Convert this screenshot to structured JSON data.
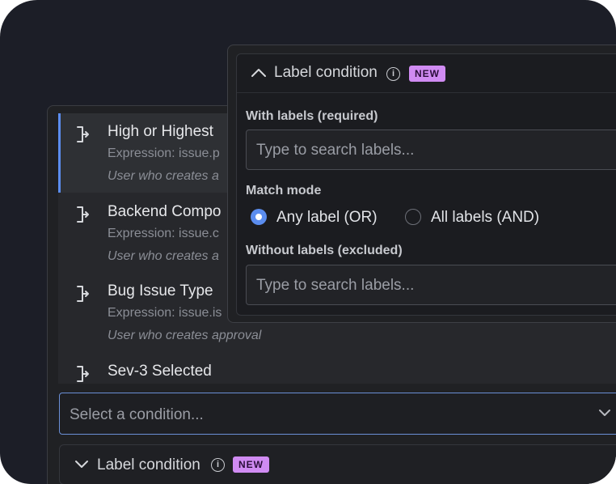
{
  "conditions": [
    {
      "title": "High or Highest",
      "expression": "Expression: issue.p",
      "creator": "User who creates a"
    },
    {
      "title": "Backend Compo",
      "expression": "Expression: issue.c",
      "creator": "User who creates a"
    },
    {
      "title": "Bug Issue Type",
      "expression": "Expression: issue.is",
      "creator": "User who creates approval"
    },
    {
      "title": "Sev-3 Selected"
    }
  ],
  "select": {
    "placeholder": "Select a condition..."
  },
  "label_condition": {
    "title": "Label condition",
    "badge": "NEW",
    "with_labels_label": "With labels (required)",
    "with_labels_placeholder": "Type to search labels...",
    "match_mode_label": "Match mode",
    "match_options": [
      {
        "label": "Any label (OR)",
        "selected": true
      },
      {
        "label": "All labels (AND)",
        "selected": false
      }
    ],
    "without_labels_label": "Without labels (excluded)",
    "without_labels_placeholder": "Type to search labels..."
  },
  "collapsed_row": {
    "title": "Label condition",
    "badge": "NEW"
  },
  "colors": {
    "accent": "#5b8def",
    "badge_bg": "#d08bf2",
    "background": "#1c1e27"
  }
}
